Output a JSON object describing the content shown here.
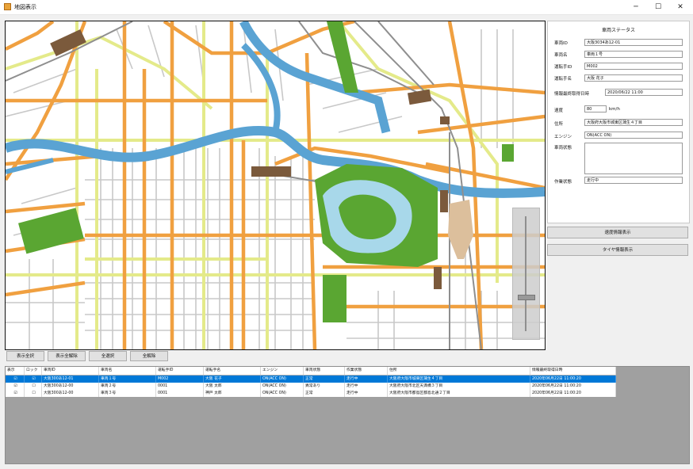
{
  "window": {
    "title": "地図表示",
    "minimize": "─",
    "maximize": "☐",
    "close": "✕"
  },
  "colors": {
    "water": "#5aa3d3",
    "park": "#5aa632",
    "major_road": "#f0a040",
    "minor_road": "#e4ea8a",
    "rail": "#9a9a9a",
    "station": "#7b5a3c",
    "selection": "#0078d7"
  },
  "status_panel": {
    "title": "車両ステータス",
    "fields": {
      "vehicle_id": {
        "label": "車両ID",
        "value": "大阪3034あ12-01"
      },
      "vehicle_name": {
        "label": "車両名",
        "value": "車両１号"
      },
      "driver_id": {
        "label": "運転手ID",
        "value": "M002"
      },
      "driver_name": {
        "label": "運転手名",
        "value": "大阪 花子"
      },
      "last_acquired": {
        "label": "情報最終取得日時",
        "value": "2020/06/22 11:00"
      },
      "speed": {
        "label": "速度",
        "value": "80",
        "unit": "km/h"
      },
      "location": {
        "label": "住所",
        "value": "大阪府大阪市城東区蒲生４丁目"
      },
      "engine": {
        "label": "エンジン",
        "value": "ON(ACC ON)"
      },
      "vehicle_state": {
        "label": "車両状態",
        "value": ""
      },
      "work_state": {
        "label": "作業状態",
        "value": "走行中"
      }
    }
  },
  "side_buttons": {
    "speed_info": "速度情報表示",
    "tire_info": "タイヤ情報表示"
  },
  "toolbar": {
    "display_all": "表示全択",
    "display_clear": "表示全解除",
    "select_all": "全選択",
    "deselect_all": "全解除"
  },
  "table": {
    "columns": [
      "表示",
      "ロック",
      "車両ID",
      "車両名",
      "運転手ID",
      "運転手名",
      "エンジン",
      "車両状態",
      "作業状態",
      "住所",
      "情報最終取得日時"
    ],
    "rows": [
      {
        "show": "☑",
        "lock": "☑",
        "vehicle_id": "大阪300あ12-01",
        "vehicle_name": "車両１号",
        "driver_id": "M002",
        "driver_name": "大阪 花子",
        "engine": "ON(ACC ON)",
        "vehicle_state": "正常",
        "work_state": "走行中",
        "address": "大阪府大阪市城東区蒲生４丁目",
        "timestamp": "2020年06月22日 11:00:20",
        "selected": true
      },
      {
        "show": "☑",
        "lock": "☐",
        "vehicle_id": "大阪300あ12-00",
        "vehicle_name": "車両２号",
        "driver_id": "0001",
        "driver_name": "大阪 太郎",
        "engine": "ON(ACC ON)",
        "vehicle_state": "異常あり",
        "work_state": "走行中",
        "address": "大阪府大阪市北区天満橋３丁目",
        "timestamp": "2020年06月22日 11:00:20",
        "selected": false
      },
      {
        "show": "☑",
        "lock": "☐",
        "vehicle_id": "大阪300あ12-00",
        "vehicle_name": "車両３号",
        "driver_id": "0001",
        "driver_name": "神戸 太郎",
        "engine": "ON(ACC ON)",
        "vehicle_state": "正常",
        "work_state": "走行中",
        "address": "大阪府大阪市都島区都島北通２丁目",
        "timestamp": "2020年06月22日 11:00:20",
        "selected": false
      }
    ]
  },
  "map": {
    "zoom_level": 0.7
  }
}
